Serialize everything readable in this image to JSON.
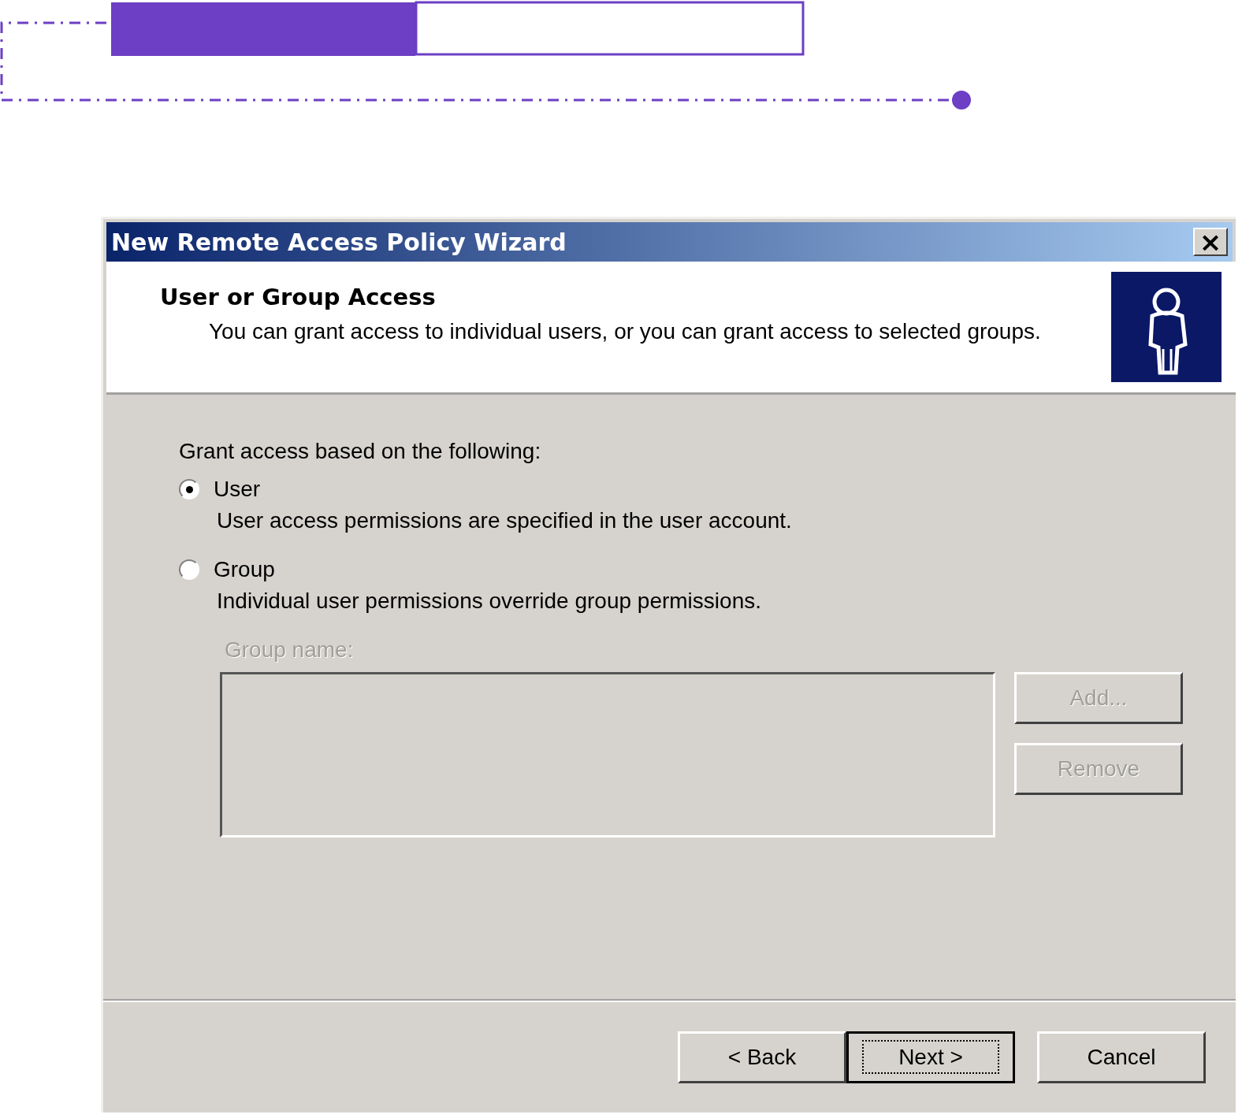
{
  "dialog": {
    "title": "New Remote Access Policy Wizard",
    "close": "×"
  },
  "header": {
    "title": "User or Group Access",
    "description": "You can grant access to individual users, or you can grant access to selected groups."
  },
  "prompt": "Grant access based on the following:",
  "options": [
    {
      "label": "User",
      "description": "User access permissions are specified in the user account.",
      "selected": true
    },
    {
      "label": "Group",
      "description": "Individual user permissions override group permissions.",
      "selected": false
    }
  ],
  "group_name": {
    "label": "Group name:",
    "disabled": true
  },
  "side_buttons": [
    {
      "label": "Add...",
      "disabled": true
    },
    {
      "label": "Remove",
      "disabled": true
    }
  ],
  "footer_buttons": [
    {
      "label": "< Back",
      "default": false
    },
    {
      "label": "Next >",
      "default": true
    },
    {
      "label": "Cancel",
      "default": false
    }
  ]
}
